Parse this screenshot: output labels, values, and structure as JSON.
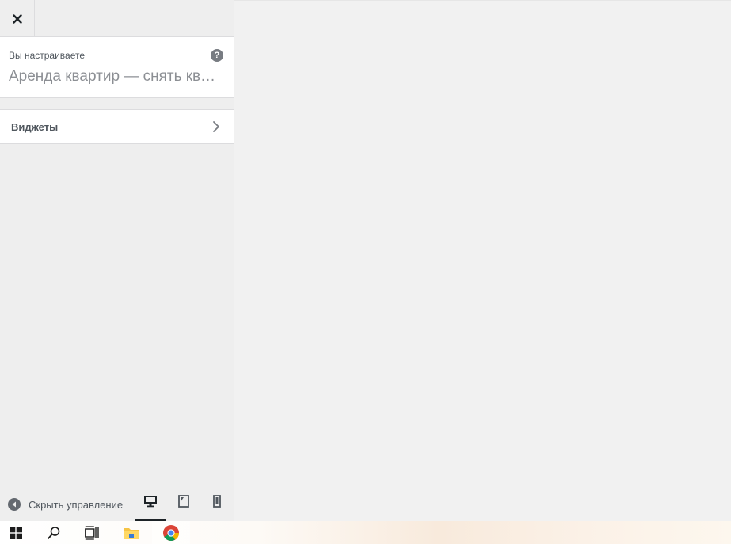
{
  "header": {
    "close_icon": "close-icon"
  },
  "info": {
    "label": "Вы настраиваете",
    "title": "Аренда квартир — снять квартиру",
    "help_icon": "help-icon",
    "help_symbol": "?"
  },
  "sections": [
    {
      "label": "Виджеты",
      "icon": "chevron-right-icon"
    }
  ],
  "footer": {
    "collapse_label": "Скрыть управление",
    "collapse_icon": "collapse-arrow-icon",
    "devices": [
      {
        "name": "desktop",
        "icon": "desktop-icon",
        "active": true
      },
      {
        "name": "tablet",
        "icon": "tablet-icon",
        "active": false
      },
      {
        "name": "mobile",
        "icon": "mobile-icon",
        "active": false
      }
    ]
  },
  "taskbar": {
    "items": [
      {
        "name": "start",
        "icon": "windows-icon"
      },
      {
        "name": "search",
        "icon": "search-icon"
      },
      {
        "name": "task-view",
        "icon": "task-view-icon"
      },
      {
        "name": "file-explorer",
        "icon": "folder-icon"
      },
      {
        "name": "chrome",
        "icon": "chrome-icon",
        "active": true
      }
    ]
  },
  "colors": {
    "accent": "#1d2327",
    "text": "#50575e",
    "muted": "#8c8f94",
    "panel": "#eeeeee"
  }
}
